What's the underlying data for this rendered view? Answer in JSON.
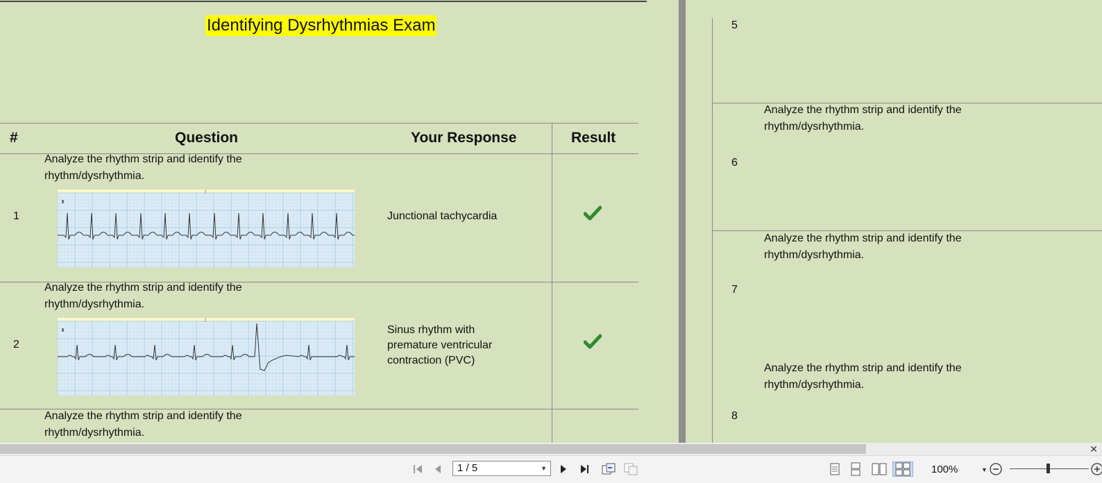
{
  "exam": {
    "title": "Identifying Dysrhythmias Exam"
  },
  "table": {
    "headers": {
      "number": "#",
      "question": "Question",
      "response": "Your Response",
      "result": "Result"
    }
  },
  "questions_left": [
    {
      "number": "1",
      "line1": "Analyze the rhythm strip and identify the",
      "line2": "rhythm/dysrhythmia.",
      "response": "Junctional tachycardia",
      "result": "correct"
    },
    {
      "number": "2",
      "line1": "Analyze the rhythm strip and identify the",
      "line2": "rhythm/dysrhythmia.",
      "response_lines": [
        "Sinus rhythm with",
        "premature ventricular",
        "contraction (PVC)"
      ],
      "result": "correct"
    },
    {
      "line1": "Analyze the rhythm strip and identify the",
      "line2": "rhythm/dysrhythmia."
    }
  ],
  "questions_right": [
    {
      "number": "5"
    },
    {
      "line1": "Analyze the rhythm strip and identify the",
      "line2": "rhythm/dysrhythmia.",
      "number": "6"
    },
    {
      "line1": "Analyze the rhythm strip and identify the",
      "line2": "rhythm/dysrhythmia.",
      "number": "7"
    },
    {
      "line1": "Analyze the rhythm strip and identify the",
      "line2": "rhythm/dysrhythmia.",
      "number": "8"
    }
  ],
  "toolbar": {
    "page_indicator": "1 / 5",
    "zoom": "100%",
    "icons": [
      "first-page-icon",
      "previous-page-icon",
      "next-page-icon",
      "last-page-icon",
      "previous-view-icon",
      "next-view-icon",
      "single-page-icon",
      "continuous-icon",
      "two-page-icon",
      "two-page-continuous-icon",
      "zoom-out-icon",
      "zoom-in-icon"
    ]
  },
  "colors": {
    "page_bg": "#d6e1bd",
    "title_highlight": "#ffff00",
    "check": "#2e8b2e",
    "ecg_grid_bg": "#dcecf7"
  }
}
